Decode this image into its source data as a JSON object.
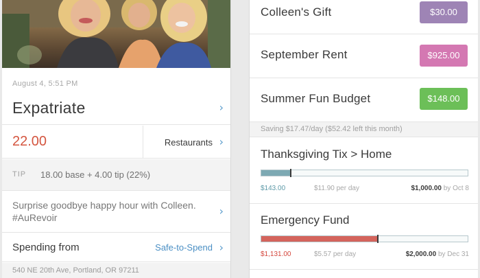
{
  "transaction": {
    "date": "August 4, 5:51 PM",
    "merchant": "Expatriate",
    "amount": "22.00",
    "category": "Restaurants",
    "tip_label": "TIP",
    "tip_text": "18.00 base + 4.00 tip (22%)",
    "note": "Surprise goodbye happy hour with Colleen. #AuRevoir",
    "spending_from_label": "Spending from",
    "spending_from_value": "Safe-to-Spend",
    "address": "540 NE 20th Ave, Portland, OR 97211"
  },
  "goals": [
    {
      "name": "Colleen's Gift",
      "amount": "$30.00",
      "color": "#9e84b5"
    },
    {
      "name": "September Rent",
      "amount": "$925.00",
      "color": "#d478b2"
    },
    {
      "name": "Summer Fun Budget",
      "amount": "$148.00",
      "color": "#6cbf58"
    }
  ],
  "saving_note": "Saving $17.47/day ($52.42 left this month)",
  "progress_goals": [
    {
      "title": "Thanksgiving Tix > Home",
      "saved": "$143.00",
      "per_day": "$11.90",
      "per_day_unit": "per day",
      "target": "$1,000.00",
      "by": "by Oct 8",
      "progress": 0.143,
      "fill_color": "#7da9b3",
      "saved_color": "#5e9aa8"
    },
    {
      "title": "Emergency Fund",
      "saved": "$1,131.00",
      "per_day": "$5.57",
      "per_day_unit": "per day",
      "target": "$2,000.00",
      "by": "by Dec 31",
      "progress": 0.5655,
      "fill_color": "#d4645c",
      "saved_color": "#d4453b"
    }
  ],
  "icons": {
    "chevron": "›"
  }
}
